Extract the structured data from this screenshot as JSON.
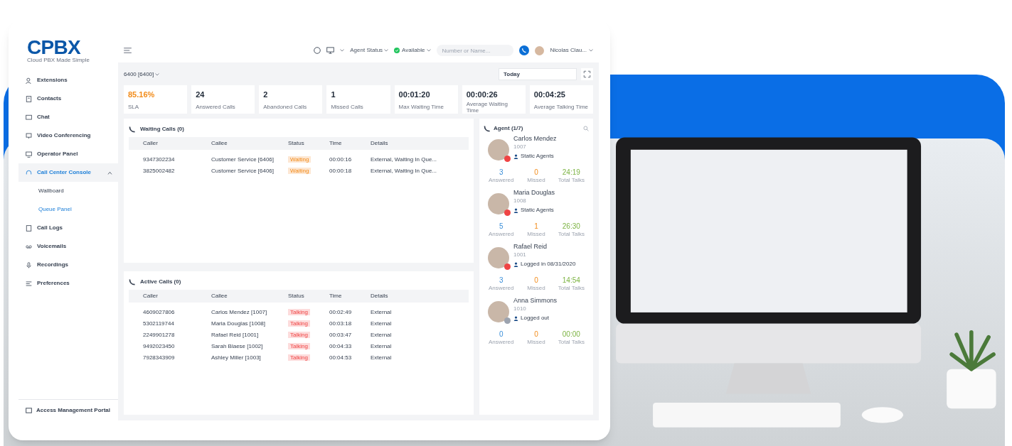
{
  "logo": {
    "text": "CPBX",
    "tagline": "Cloud PBX Made Simple"
  },
  "sidebar": {
    "items": [
      {
        "label": "Extensions",
        "selected": false
      },
      {
        "label": "Contacts",
        "selected": false
      },
      {
        "label": "Chat",
        "selected": false
      },
      {
        "label": "Video Conferencing",
        "selected": false
      },
      {
        "label": "Operator Panel",
        "selected": false
      },
      {
        "label": "Call Center Console",
        "selected": true,
        "expanded": true,
        "children": [
          {
            "label": "Wallboard",
            "selected": false
          },
          {
            "label": "Queue Panel",
            "selected": true
          }
        ]
      },
      {
        "label": "Call Logs",
        "selected": false
      },
      {
        "label": "Voicemails",
        "selected": false
      },
      {
        "label": "Recordings",
        "selected": false
      },
      {
        "label": "Preferences",
        "selected": false
      }
    ],
    "footer": "Access Management Portal"
  },
  "topbar": {
    "agent_status": "Agent Status",
    "availability": "Available",
    "search_placeholder": "Number or Name...",
    "user": "Nicolas Clau..."
  },
  "queue": {
    "name": "6400 [6400]",
    "period": "Today"
  },
  "stats": [
    {
      "value": "85.16%",
      "label": "SLA",
      "highlight": true
    },
    {
      "value": "24",
      "label": "Answered Calls",
      "highlight": false
    },
    {
      "value": "2",
      "label": "Abandoned Calls",
      "highlight": false
    },
    {
      "value": "1",
      "label": "Missed Calls",
      "highlight": false
    },
    {
      "value": "00:01:20",
      "label": "Max Waiting Time",
      "highlight": false
    },
    {
      "value": "00:00:26",
      "label": "Average Waiting Time",
      "highlight": false
    },
    {
      "value": "00:04:25",
      "label": "Average Talking Time",
      "highlight": false
    }
  ],
  "waiting_calls": {
    "title": "Waiting Calls (0)",
    "columns": [
      "Caller",
      "Callee",
      "Status",
      "Time",
      "Details"
    ],
    "rows": [
      {
        "caller": "9347302234",
        "callee": "Customer Service [6406]",
        "status": "Waiting",
        "kind": "waiting",
        "time": "00:00:16",
        "details": "External, Waiting In Que..."
      },
      {
        "caller": "3825002482",
        "callee": "Customer Service [6406]",
        "status": "Waiting",
        "kind": "waiting",
        "time": "00:00:18",
        "details": "External, Waiting In Que..."
      }
    ]
  },
  "active_calls": {
    "title": "Active Calls (0)",
    "columns": [
      "Caller",
      "Callee",
      "Status",
      "Time",
      "Details"
    ],
    "rows": [
      {
        "caller": "4609027806",
        "callee": "Carlos Mendez [1007]",
        "status": "Talking",
        "kind": "talking",
        "time": "00:02:49",
        "details": "External"
      },
      {
        "caller": "5302119744",
        "callee": "Maria Douglas [1008]",
        "status": "Talking",
        "kind": "talking",
        "time": "00:03:18",
        "details": "External"
      },
      {
        "caller": "2249901278",
        "callee": "Rafael Reid [1001]",
        "status": "Talking",
        "kind": "talking",
        "time": "00:03:47",
        "details": "External"
      },
      {
        "caller": "9492023450",
        "callee": "Sarah Blaese [1002]",
        "status": "Talking",
        "kind": "talking",
        "time": "00:04:33",
        "details": "External"
      },
      {
        "caller": "7928343909",
        "callee": "Ashley Miller [1003]",
        "status": "Talking",
        "kind": "talking",
        "time": "00:04:53",
        "details": "External"
      }
    ]
  },
  "agents": {
    "title": "Agent (1/7)",
    "items": [
      {
        "name": "Carlos Mendez",
        "ext": "1007",
        "tag": "Static Agents",
        "color": "#ef4444",
        "answered": "3",
        "missed": "0",
        "total": "24:19",
        "stat_labels": [
          "Answered",
          "Missed",
          "Total Talks"
        ]
      },
      {
        "name": "Maria Douglas",
        "ext": "1008",
        "tag": "Static Agents",
        "color": "#ef4444",
        "answered": "5",
        "missed": "1",
        "total": "26:30",
        "stat_labels": [
          "Answered",
          "Missed",
          "Total Talks"
        ]
      },
      {
        "name": "Rafael Reid",
        "ext": "1001",
        "tag": "Logged in 08/31/2020",
        "color": "#ef4444",
        "answered": "3",
        "missed": "0",
        "total": "14:54",
        "stat_labels": [
          "Answered",
          "Missed",
          "Total Talks"
        ]
      },
      {
        "name": "Anna Simmons",
        "ext": "1010",
        "tag": "Logged out",
        "color": "#9ca3af",
        "answered": "0",
        "missed": "0",
        "total": "00:00",
        "stat_labels": [
          "Answered",
          "Missed",
          "Total Talks"
        ]
      }
    ]
  }
}
